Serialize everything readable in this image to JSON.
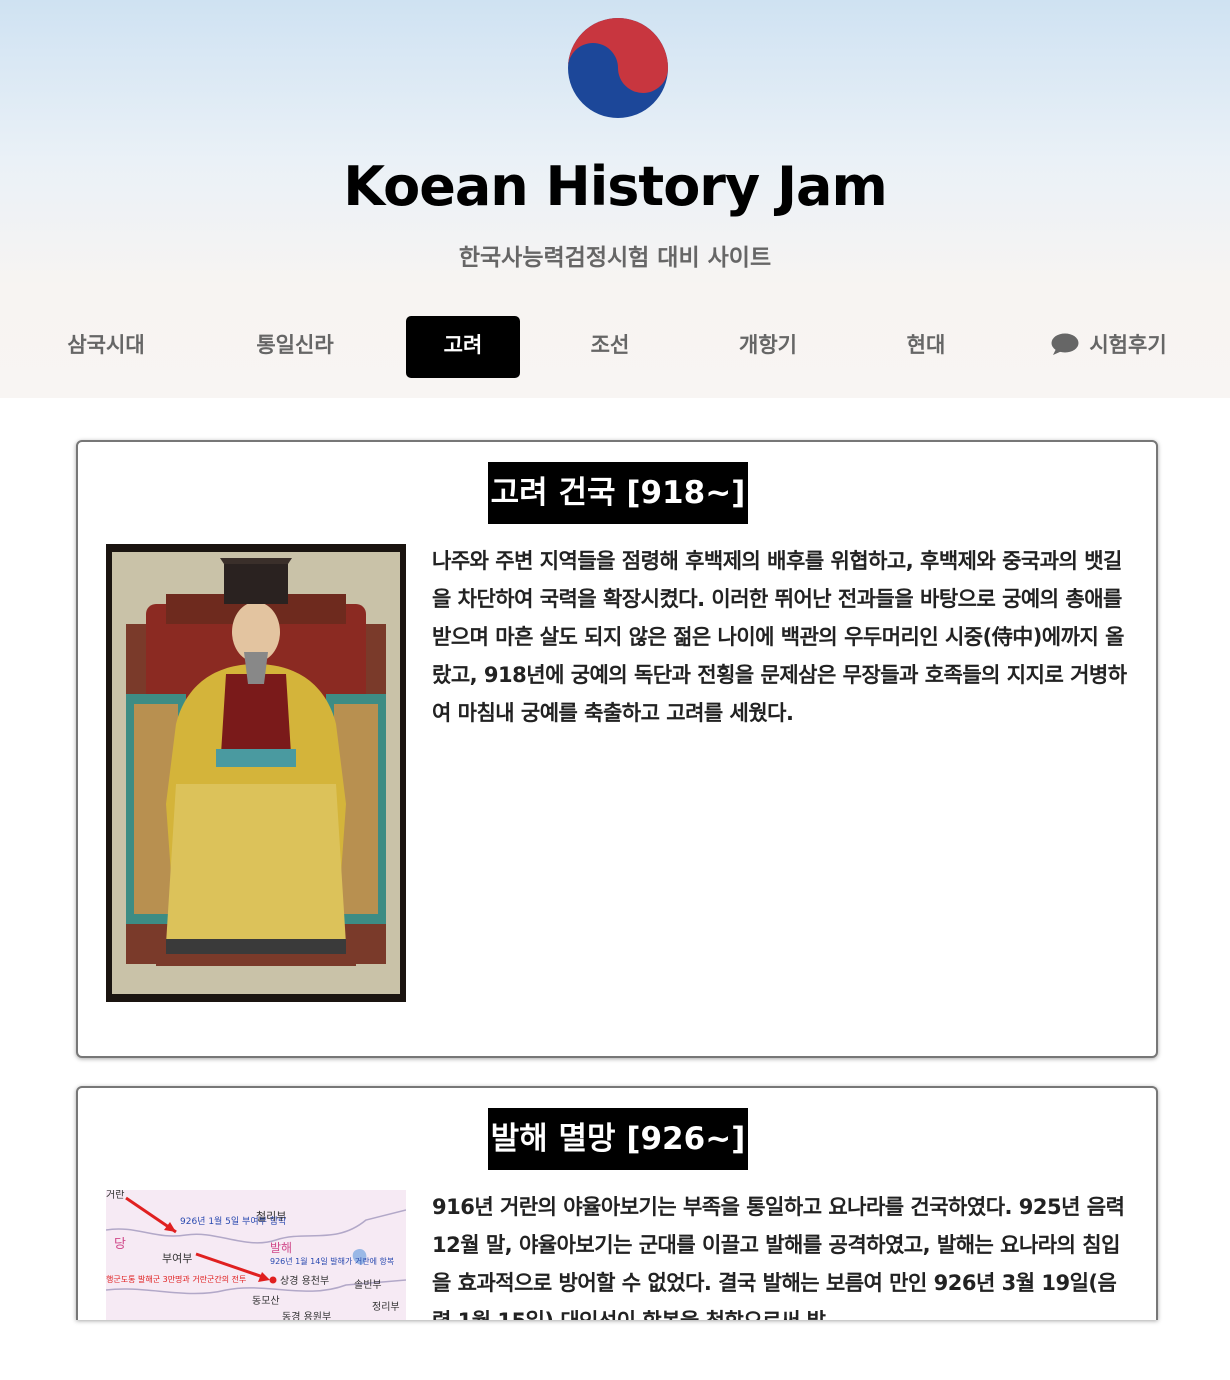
{
  "header": {
    "title": "Koean History Jam",
    "subtitle": "한국사능력검정시험 대비 사이트"
  },
  "nav": {
    "items": [
      {
        "label": "삼국시대"
      },
      {
        "label": "통일신라"
      },
      {
        "label": "고려"
      },
      {
        "label": "조선"
      },
      {
        "label": "개항기"
      },
      {
        "label": "현대"
      },
      {
        "label": "시험후기",
        "icon": "chat-icon"
      }
    ],
    "active": "고려"
  },
  "cards": [
    {
      "title": "고려 건국 [918~]",
      "text": "나주와 주변 지역들을 점령해 후백제의 배후를 위협하고, 후백제와 중국과의 뱃길을 차단하여 국력을 확장시켰다. 이러한 뛰어난 전과들을 바탕으로 궁예의 총애를 받으며 마흔 살도 되지 않은 젊은 나이에 백관의 우두머리인 시중(侍中)에까지 올랐고, 918년에 궁예의 독단과 전횡을 문제삼은 무장들과 호족들의 지지로 거병하여 마침내 궁예를 축출하고 고려를 세웠다."
    },
    {
      "title": "발해 멸망 [926~]",
      "text": "916년 거란의 야율아보기는 부족을 통일하고 요나라를 건국하였다. 925년 음력 12월 말, 야율아보기는 군대를 이끌고 발해를 공격하였고, 발해는 요나라의 침입을 효과적으로 방어할 수 없었다. 결국 발해는 보름여 만인 926년 3월 19일(음력 1월 15일) 대인선이 항복을 청함으로써 발",
      "map_labels": {
        "label_1": "926년 1월 5일 부여부 함락",
        "label_2": "926년 1월 14일 발해가 거란에 항복",
        "label_3": "행군도통 발해군 3만명과 거란군간의 전투",
        "place_1": "거란",
        "place_2": "당",
        "place_3": "철리부",
        "place_4": "부여부",
        "place_5": "발해",
        "place_6": "상경 용천부",
        "place_7": "솔빈부",
        "place_8": "동모산",
        "place_9": "정리부",
        "place_10": "동경 용원부"
      }
    }
  ],
  "colors": {
    "accent": "#000000",
    "flag_red": "#c8363f",
    "flag_blue": "#1c4799"
  }
}
